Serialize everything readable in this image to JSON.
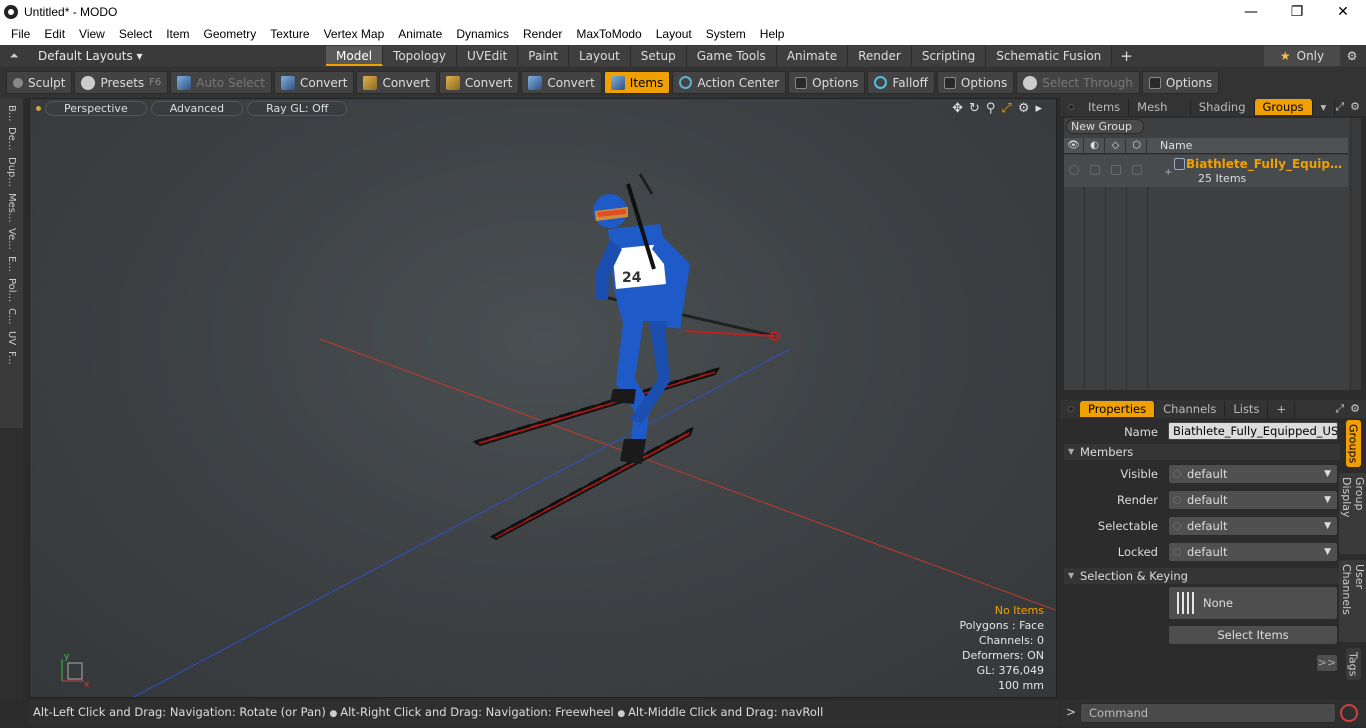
{
  "window": {
    "title": "Untitled* - MODO"
  },
  "menubar": [
    "File",
    "Edit",
    "View",
    "Select",
    "Item",
    "Geometry",
    "Texture",
    "Vertex Map",
    "Animate",
    "Dynamics",
    "Render",
    "MaxToModo",
    "Layout",
    "System",
    "Help"
  ],
  "layoutbar": {
    "layout_select": "Default Layouts ▾",
    "tabs": [
      "Model",
      "Topology",
      "UVEdit",
      "Paint",
      "Layout",
      "Setup",
      "Game Tools",
      "Animate",
      "Render",
      "Scripting",
      "Schematic Fusion"
    ],
    "active_tab": "Model",
    "only_label": "Only"
  },
  "toolbar": {
    "sculpt": "Sculpt",
    "presets": "Presets",
    "presets_key": "F6",
    "auto_select": "Auto Select",
    "convert": "Convert",
    "items": "Items",
    "action_center": "Action Center",
    "options": "Options",
    "falloff": "Falloff",
    "select_through": "Select Through"
  },
  "lefttabs": [
    "B...",
    "De...",
    "Dup...",
    "Mes...",
    "Ve...",
    "E...",
    "Pol...",
    "C...",
    "UV",
    "F..."
  ],
  "viewport": {
    "perspective": "Perspective",
    "advanced": "Advanced",
    "raygl": "Ray GL: Off",
    "stats": {
      "no_items": "No Items",
      "polygons": "Polygons : Face",
      "channels": "Channels: 0",
      "deformers": "Deformers: ON",
      "gl": "GL: 376,049",
      "scale": "100 mm"
    },
    "axis_y": "y",
    "axis_x": "x"
  },
  "statusbar": {
    "hint1": "Alt-Left Click and Drag: Navigation: Rotate (or Pan)",
    "hint2": "Alt-Right Click and Drag: Navigation: Freewheel",
    "hint3": "Alt-Middle Click and Drag: navRoll"
  },
  "groups_panel": {
    "tabs": [
      "Items",
      "Mesh ...",
      "Shading",
      "Groups"
    ],
    "active_tab": "Groups",
    "new_group": "New Group",
    "name_header": "Name",
    "group_name": "Biathlete_Fully_Equipped_USA_T",
    "group_count": "25 Items"
  },
  "properties_panel": {
    "tabs": [
      "Properties",
      "Channels",
      "Lists"
    ],
    "active_tab": "Properties",
    "name_label": "Name",
    "name_value": "Biathlete_Fully_Equipped_USA_T",
    "members_section": "Members",
    "visible_label": "Visible",
    "visible_value": "default",
    "render_label": "Render",
    "render_value": "default",
    "selectable_label": "Selectable",
    "selectable_value": "default",
    "locked_label": "Locked",
    "locked_value": "default",
    "selection_section": "Selection & Keying",
    "none_label": "None",
    "select_items": "Select Items",
    "more": ">>"
  },
  "side_vtabs": [
    "Groups",
    "Group Display",
    "User Channels",
    "Tags"
  ],
  "command": {
    "placeholder": "Command",
    "prompt": ">"
  },
  "colors": {
    "accent": "#f0a000",
    "suit": "#1f5bc8",
    "ski": "#c02020"
  }
}
